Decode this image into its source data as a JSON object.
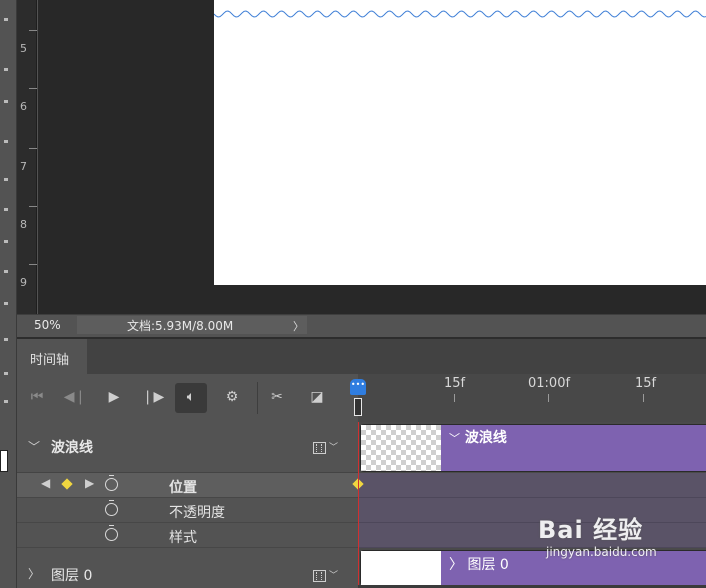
{
  "ruler": {
    "marks": [
      "5",
      "6",
      "7",
      "8",
      "9"
    ]
  },
  "status": {
    "zoom": "50%",
    "doc_info": "文档:5.93M/8.00M",
    "arrow": "〉"
  },
  "timeline": {
    "tab_label": "时间轴",
    "controls": {
      "first_frame_icon": "skip-to-first-icon",
      "prev_frame_icon": "previous-frame-icon",
      "play_icon": "play-icon",
      "next_frame_icon": "next-frame-icon",
      "audio_icon": "speaker-icon",
      "settings_icon": "gear-icon",
      "split_icon": "scissors-icon",
      "transition_icon": "transition-icon"
    },
    "time_labels": [
      "15f",
      "01:00f",
      "15f"
    ],
    "tracks": [
      {
        "name": "波浪线",
        "expanded": true,
        "clip_label": "波浪线",
        "properties": [
          "位置",
          "不透明度",
          "样式"
        ]
      },
      {
        "name": "图层 0",
        "expanded": false,
        "clip_label": "图层 0"
      }
    ]
  },
  "watermark": {
    "main": "Bai 经验",
    "sub": "jingyan.baidu.com"
  },
  "colors": {
    "clip": "#7e62b0",
    "playhead": "#2f7de0",
    "keyframe": "#f0d640",
    "cti_line": "#d03030",
    "wave": "#3f7fd6"
  }
}
